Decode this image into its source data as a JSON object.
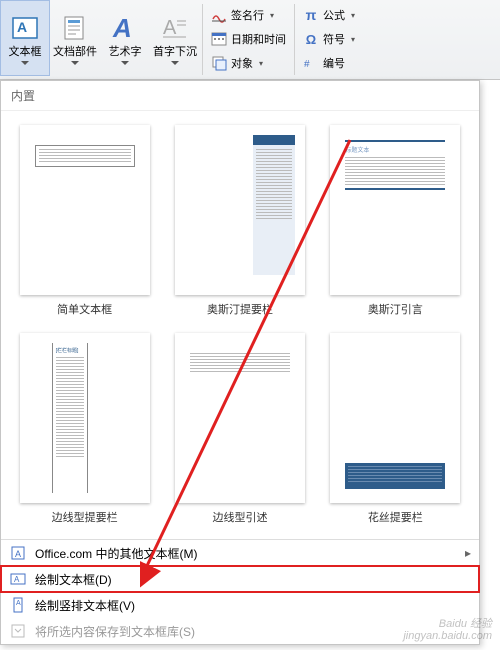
{
  "ribbon": {
    "textbox": "文本框",
    "quickparts": "文档部件",
    "wordart": "艺术字",
    "dropcap": "首字下沉",
    "sigline": "签名行",
    "datetime": "日期和时间",
    "object": "对象",
    "equation": "公式",
    "symbol": "符号",
    "number": "编号"
  },
  "gallery": {
    "header": "内置",
    "items": [
      {
        "label": "简单文本框"
      },
      {
        "label": "奥斯汀提要栏"
      },
      {
        "label": "奥斯汀引言"
      },
      {
        "label": "边线型提要栏"
      },
      {
        "label": "边线型引述"
      },
      {
        "label": "花丝提要栏"
      }
    ],
    "menu": {
      "more": "Office.com 中的其他文本框(M)",
      "draw": "绘制文本框(D)",
      "drawv": "绘制竖排文本框(V)",
      "save": "将所选内容保存到文本框库(S)"
    }
  },
  "watermark": {
    "l1": "Baidu 经验",
    "l2": "jingyan.baidu.com"
  }
}
